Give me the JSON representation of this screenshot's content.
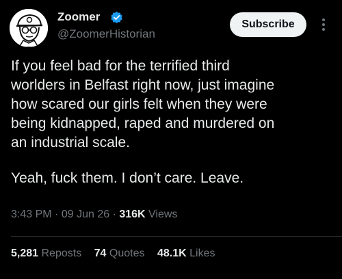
{
  "author": {
    "display_name": "Zoomer",
    "handle": "@ZoomerHistorian",
    "avatar_icon": "cartoon-soldier-avatar",
    "verified_icon": "verified-badge-icon",
    "verified_color": "#1d9bf0"
  },
  "actions": {
    "subscribe_label": "Subscribe",
    "more_icon": "more-dots-icon"
  },
  "post": {
    "lines": [
      "If you feel bad for the terrified third",
      "worlders in Belfast right now, just imagine",
      "how scared our girls felt when they were",
      "being kidnapped, raped and murdered on",
      "an industrial scale.",
      "Yeah, fuck them. I don’t care. Leave."
    ]
  },
  "meta": {
    "time": "3:43 PM",
    "separator": "·",
    "date": "09 Jun 26",
    "views_count": "316K",
    "views_label": "Views"
  },
  "stats": {
    "reposts_count": "5,281",
    "reposts_label": "Reposts",
    "quotes_count": "74",
    "quotes_label": "Quotes",
    "likes_count": "48.1K",
    "likes_label": "Likes"
  },
  "colors": {
    "background": "#000000",
    "text": "#e7e9ea",
    "secondary_text": "#71767b",
    "divider": "#2f3336",
    "button_bg": "#eff3f4"
  }
}
